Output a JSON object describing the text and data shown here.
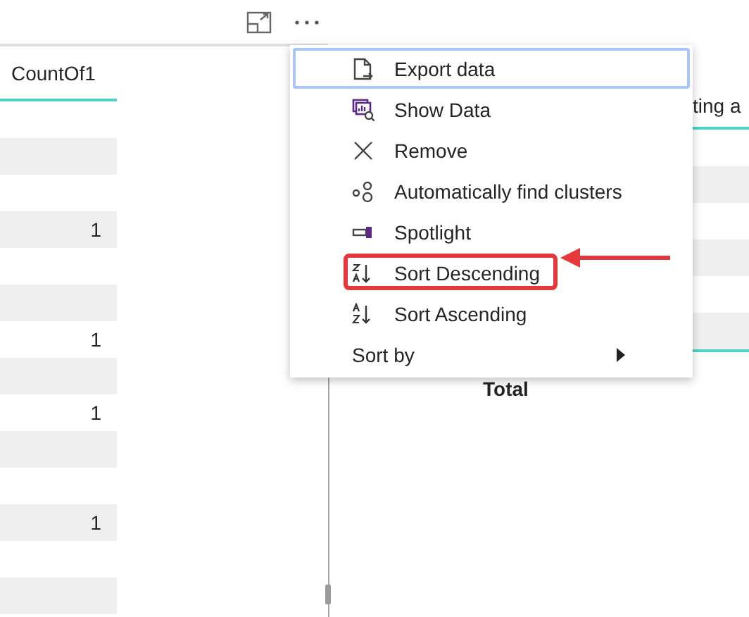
{
  "left_visual": {
    "header": "CountOf1",
    "rows": [
      {
        "kind": "empty"
      },
      {
        "kind": "empty"
      },
      {
        "kind": "empty"
      },
      {
        "kind": "value",
        "value": "1"
      },
      {
        "kind": "empty"
      },
      {
        "kind": "empty"
      },
      {
        "kind": "value",
        "value": "1"
      },
      {
        "kind": "empty"
      },
      {
        "kind": "value",
        "value": "1"
      },
      {
        "kind": "empty"
      },
      {
        "kind": "empty"
      },
      {
        "kind": "value",
        "value": "1"
      },
      {
        "kind": "empty"
      },
      {
        "kind": "empty"
      }
    ]
  },
  "right_visual": {
    "header": "ting a",
    "total": "Total"
  },
  "context_menu": {
    "items": [
      {
        "kind": "export",
        "label": "Export data",
        "focused": true,
        "annotated": false,
        "submenu": false
      },
      {
        "kind": "show-data",
        "label": "Show Data",
        "focused": false,
        "annotated": false,
        "submenu": false
      },
      {
        "kind": "remove",
        "label": "Remove",
        "focused": false,
        "annotated": false,
        "submenu": false
      },
      {
        "kind": "clusters",
        "label": "Automatically find clusters",
        "focused": false,
        "annotated": false,
        "submenu": false
      },
      {
        "kind": "spotlight",
        "label": "Spotlight",
        "focused": false,
        "annotated": false,
        "submenu": false
      },
      {
        "kind": "sort-desc",
        "label": "Sort Descending",
        "focused": false,
        "annotated": true,
        "submenu": false
      },
      {
        "kind": "sort-asc",
        "label": "Sort Ascending",
        "focused": false,
        "annotated": false,
        "submenu": false
      },
      {
        "kind": "none",
        "label": "Sort by",
        "focused": false,
        "annotated": false,
        "submenu": true
      }
    ]
  }
}
